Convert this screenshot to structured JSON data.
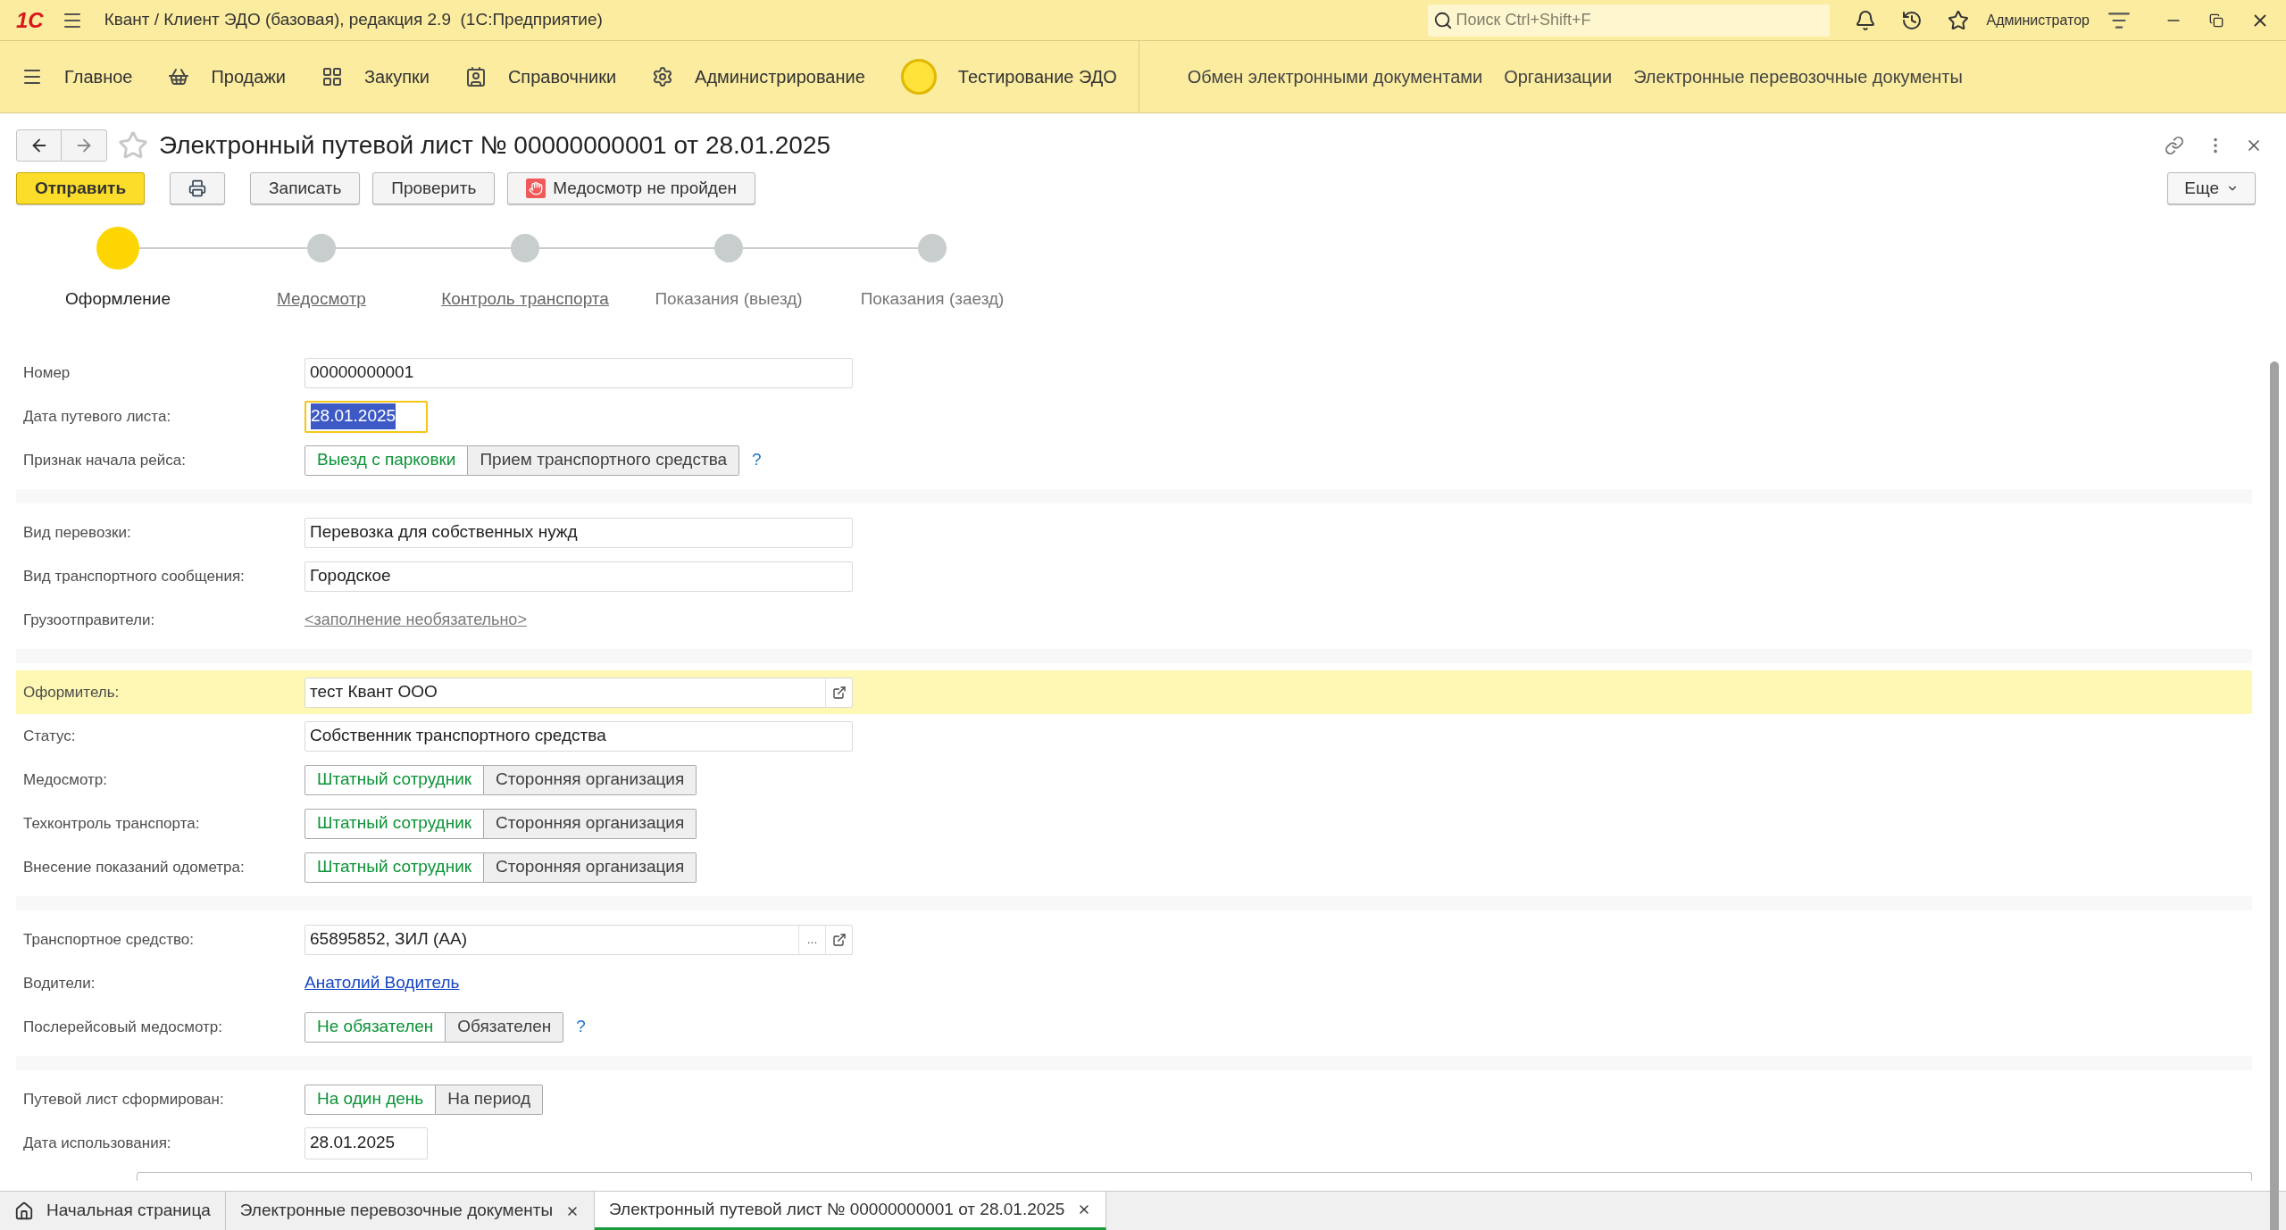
{
  "title_bar": {
    "logo": "1С",
    "app_title": "Квант / Клиент ЭДО (базовая), редакция 2.9  (1С:Предприятие)",
    "search": {
      "placeholder": "Поиск Ctrl+Shift+F"
    },
    "user": "Администратор"
  },
  "sections": [
    {
      "label": "Главное",
      "kind": "main"
    },
    {
      "label": "Продажи",
      "kind": "sales"
    },
    {
      "label": "Закупки",
      "kind": "purchases"
    },
    {
      "label": "Справочники",
      "kind": "catalogs"
    },
    {
      "label": "Администрирование",
      "kind": "admin"
    },
    {
      "label": "Тестирование ЭДО",
      "kind": "testing"
    }
  ],
  "quick_links": [
    "Обмен электронными документами",
    "Организации",
    "Электронные перевозочные документы"
  ],
  "document": {
    "title": "Электронный путевой лист № 00000000001 от 28.01.2025",
    "buttons": [
      {
        "label": "Отправить",
        "kind": "primary"
      },
      {
        "kind": "print"
      },
      {
        "label": "Записать",
        "kind": "default"
      },
      {
        "label": "Проверить",
        "kind": "default"
      },
      {
        "label": "Медосмотр не пройден",
        "kind": "stop"
      }
    ],
    "more_button": "Еще"
  },
  "steps": [
    {
      "label": "Оформление",
      "selected": true,
      "kind": "text"
    },
    {
      "label": "Медосмотр",
      "selected": false,
      "kind": "link"
    },
    {
      "label": "Контроль транспорта",
      "selected": false,
      "kind": "link"
    },
    {
      "label": "Показания (выезд)",
      "selected": false,
      "kind": "text"
    },
    {
      "label": "Показания (заезд)",
      "selected": false,
      "kind": "text"
    }
  ],
  "form_groups": [
    {
      "rows": [
        {
          "label": "Номер",
          "kind": "input",
          "value": "00000000001",
          "highlighted": false
        },
        {
          "label": "Дата путевого листа:",
          "kind": "date",
          "value": "28.01.2025",
          "focused": true,
          "highlighted": false
        },
        {
          "label": "Признак начала рейса:",
          "kind": "toggle",
          "options": [
            {
              "label": "Выезд с парковки",
              "selected": true
            },
            {
              "label": "Прием транспортного средства",
              "selected": false
            }
          ],
          "help": "?",
          "highlighted": false
        }
      ]
    },
    {
      "rows": [
        {
          "label": "Вид перевозки:",
          "kind": "input",
          "value": "Перевозка для собственных нужд",
          "highlighted": false
        },
        {
          "label": "Вид транспортного сообщения:",
          "kind": "input",
          "value": "Городское",
          "highlighted": false
        },
        {
          "label": "Грузоотправители:",
          "kind": "hint_link",
          "value": "<заполнение необязательно>",
          "highlighted": false
        }
      ]
    },
    {
      "rows": [
        {
          "label": "Оформитель:",
          "kind": "ref",
          "value": "тест Квант ООО",
          "highlighted": true
        },
        {
          "label": "Статус:",
          "kind": "input",
          "value": "Собственник транспортного средства",
          "highlighted": false
        },
        {
          "label": "Медосмотр:",
          "kind": "toggle",
          "options": [
            {
              "label": "Штатный сотрудник",
              "selected": true
            },
            {
              "label": "Сторонняя организация",
              "selected": false
            }
          ],
          "highlighted": false
        },
        {
          "label": "Техконтроль транспорта:",
          "kind": "toggle",
          "options": [
            {
              "label": "Штатный сотрудник",
              "selected": true
            },
            {
              "label": "Сторонняя организация",
              "selected": false
            }
          ],
          "highlighted": false
        },
        {
          "label": "Внесение показаний одометра:",
          "kind": "toggle",
          "options": [
            {
              "label": "Штатный сотрудник",
              "selected": true
            },
            {
              "label": "Сторонняя организация",
              "selected": false
            }
          ],
          "highlighted": false
        }
      ]
    },
    {
      "rows": [
        {
          "label": "Транспортное средство:",
          "kind": "ref",
          "value": "65895852, ЗИЛ  (АА)",
          "choice_button": "...",
          "highlighted": false
        },
        {
          "label": "Водители:",
          "kind": "link",
          "value": "Анатолий Водитель",
          "highlighted": false
        },
        {
          "label": "Послерейсовый медосмотр:",
          "kind": "toggle",
          "options": [
            {
              "label": "Не обязателен",
              "selected": true
            },
            {
              "label": "Обязателен",
              "selected": false
            }
          ],
          "help": "?",
          "highlighted": false
        }
      ]
    },
    {
      "rows": [
        {
          "label": "Путевой лист сформирован:",
          "kind": "toggle",
          "options": [
            {
              "label": "На один день",
              "selected": true
            },
            {
              "label": "На период",
              "selected": false
            }
          ],
          "highlighted": false
        },
        {
          "label": "Дата использования:",
          "kind": "date",
          "value": "28.01.2025",
          "focused": false,
          "highlighted": false
        }
      ]
    }
  ],
  "tabs": [
    {
      "label": "Начальная страница",
      "kind": "home",
      "selected": false
    },
    {
      "label": "Электронные перевозочные документы",
      "kind": "closable",
      "selected": false
    },
    {
      "label": "Электронный путевой лист № 00000000001 от 28.01.2025",
      "kind": "closable",
      "selected": true
    }
  ]
}
